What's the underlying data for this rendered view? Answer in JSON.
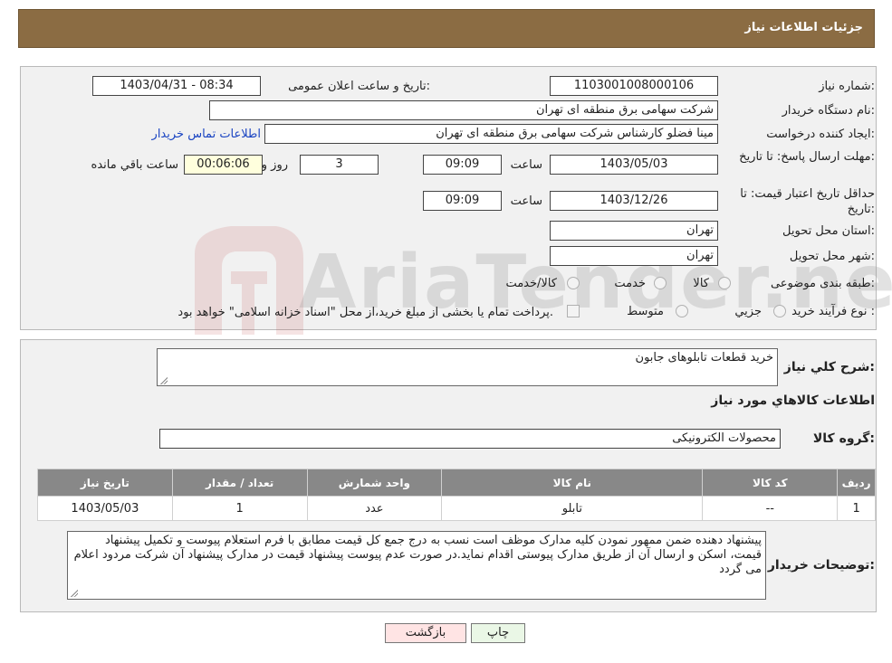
{
  "header": {
    "title": "جزئیات اطلاعات نیاز"
  },
  "details": {
    "need_number_label": "شماره نیاز:",
    "need_number": "1103001008000106",
    "announce_label": "تاریخ و ساعت اعلان عمومی:",
    "announce_value": "1403/04/31 - 08:34",
    "buyer_org_label": "نام دستگاه خریدار:",
    "buyer_org": "شرکت سهامی برق منطقه ای تهران",
    "requester_label": "ایجاد کننده درخواست:",
    "requester": "مینا فضلو کارشناس شرکت سهامی برق منطقه ای تهران",
    "contact_link": "اطلاعات تماس خریدار",
    "deadline_label": "مهلت ارسال پاسخ: تا تاریخ:",
    "deadline_date": "1403/05/03",
    "time_label": "ساعت",
    "deadline_time": "09:09",
    "days_value": "3",
    "days_label": "روز و",
    "remaining_time": "00:06:06",
    "remaining_label": "ساعت باقي مانده",
    "validity_label": "حداقل تاریخ اعتبار قیمت: تا تاریخ:",
    "validity_date": "1403/12/26",
    "validity_time": "09:09",
    "province_label": "استان محل تحویل:",
    "province": "تهران",
    "city_label": "شهر محل تحویل:",
    "city": "تهران",
    "category_label": "طبقه بندی موضوعی:",
    "category_options": [
      "کالا",
      "خدمت",
      "کالا/خدمت"
    ],
    "purchase_type_label": "نوع فرآیند خرید :",
    "purchase_options": [
      "جزيي",
      "متوسط"
    ],
    "payment_note": "پرداخت تمام یا بخشی از مبلغ خرید،از محل \"اسناد خزانه اسلامی\" خواهد بود."
  },
  "description": {
    "label": "شرح کلي نياز:",
    "value": "خرید قطعات تابلوهای جابون"
  },
  "goods_section": {
    "title": "اطلاعات کالاهاي مورد نياز",
    "group_label": "گروه کالا:",
    "group_value": "محصولات الکترونیکی"
  },
  "table": {
    "columns": [
      "رديف",
      "کد کالا",
      "نام کالا",
      "واحد شمارش",
      "تعداد / مقدار",
      "تاریخ نیاز"
    ],
    "rows": [
      [
        "1",
        "--",
        "تابلو",
        "عدد",
        "1",
        "1403/05/03"
      ]
    ]
  },
  "buyer_notes": {
    "label": "توضیحات خریدار:",
    "value": "پیشنهاد دهنده ضمن ممهور نمودن کلیه مدارک موظف است نسب به درج جمع کل قیمت مطابق با فرم استعلام پیوست و تکمیل پیشنهاد قیمت، اسکن و ارسال آن از طریق مدارک پیوستی اقدام نماید.در صورت عدم پیوست پیشنهاد قیمت در مدارک پیشنهاد آن شرکت مردود اعلام می گردد"
  },
  "buttons": {
    "print": "چاپ",
    "back": "بازگشت"
  },
  "watermark": {
    "text": "AriaTender.neT"
  },
  "colors": {
    "header_bg": "#8b6c43",
    "table_header": "#888888",
    "back_btn": "#ffe4e4",
    "print_btn": "#eaf7e6"
  }
}
